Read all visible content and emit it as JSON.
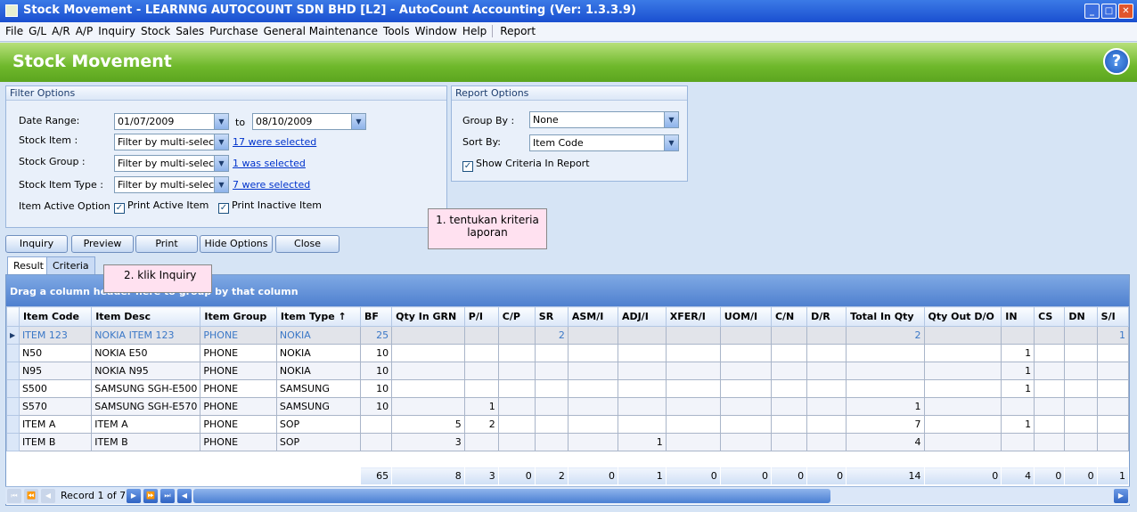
{
  "window": {
    "title": "Stock Movement - LEARNNG AUTOCOUNT SDN BHD [L2] - AutoCount Accounting (Ver: 1.3.3.9)"
  },
  "menu": [
    "File",
    "G/L",
    "A/R",
    "A/P",
    "Inquiry",
    "Stock",
    "Sales",
    "Purchase",
    "General Maintenance",
    "Tools",
    "Window",
    "Help",
    "Report"
  ],
  "banner": {
    "title": "Stock Movement",
    "help": "?"
  },
  "filter": {
    "title": "Filter Options",
    "date_range_label": "Date Range:",
    "date_from": "01/07/2009",
    "to_label": "to",
    "date_to": "08/10/2009",
    "stock_item_label": "Stock Item :",
    "stock_item_value": "Filter by multi-select",
    "stock_item_link": "17 were selected",
    "stock_group_label": "Stock Group :",
    "stock_group_value": "Filter by multi-select",
    "stock_group_link": "1 was selected",
    "stock_type_label": "Stock Item Type :",
    "stock_type_value": "Filter by multi-select",
    "stock_type_link": "7 were selected",
    "active_label": "Item Active Option :",
    "print_active": "Print Active Item",
    "print_inactive": "Print Inactive Item"
  },
  "report": {
    "title": "Report Options",
    "group_label": "Group By :",
    "group_value": "None",
    "sort_label": "Sort By:",
    "sort_value": "Item Code",
    "show_criteria": "Show Criteria In Report"
  },
  "callouts": {
    "one": "1. tentukan kriteria laporan",
    "two": "2. klik Inquiry"
  },
  "buttons": {
    "inquiry": "Inquiry",
    "preview": "Preview",
    "print": "Print",
    "hide": "Hide Options",
    "close": "Close"
  },
  "tabs": {
    "result": "Result",
    "criteria": "Criteria"
  },
  "grid": {
    "drag_hint": "Drag a column header here to group by that column",
    "columns": [
      "Item Code",
      "Item Desc",
      "Item Group",
      "Item Type ↑",
      "BF",
      "Qty In GRN",
      "P/I",
      "C/P",
      "SR",
      "ASM/I",
      "ADJ/I",
      "XFER/I",
      "UOM/I",
      "C/N",
      "D/R",
      "Total In Qty",
      "Qty Out D/O",
      "IN",
      "CS",
      "DN",
      "S/I"
    ],
    "rows": [
      [
        "ITEM 123",
        "NOKIA ITEM 123",
        "PHONE",
        "NOKIA",
        "25",
        "",
        "",
        "",
        "2",
        "",
        "",
        "",
        "",
        "",
        "",
        "2",
        "",
        "",
        "",
        "",
        "1"
      ],
      [
        "N50",
        "NOKIA E50",
        "PHONE",
        "NOKIA",
        "10",
        "",
        "",
        "",
        "",
        "",
        "",
        "",
        "",
        "",
        "",
        "",
        "",
        "1",
        "",
        "",
        ""
      ],
      [
        "N95",
        "NOKIA N95",
        "PHONE",
        "NOKIA",
        "10",
        "",
        "",
        "",
        "",
        "",
        "",
        "",
        "",
        "",
        "",
        "",
        "",
        "1",
        "",
        "",
        ""
      ],
      [
        "S500",
        "SAMSUNG SGH-E500",
        "PHONE",
        "SAMSUNG",
        "10",
        "",
        "",
        "",
        "",
        "",
        "",
        "",
        "",
        "",
        "",
        "",
        "",
        "1",
        "",
        "",
        ""
      ],
      [
        "S570",
        "SAMSUNG SGH-E570",
        "PHONE",
        "SAMSUNG",
        "10",
        "",
        "1",
        "",
        "",
        "",
        "",
        "",
        "",
        "",
        "",
        "1",
        "",
        "",
        "",
        "",
        ""
      ],
      [
        "ITEM A",
        "ITEM A",
        "PHONE",
        "SOP",
        "",
        "5",
        "2",
        "",
        "",
        "",
        "",
        "",
        "",
        "",
        "",
        "7",
        "",
        "1",
        "",
        "",
        ""
      ],
      [
        "ITEM B",
        "ITEM B",
        "PHONE",
        "SOP",
        "",
        "3",
        "",
        "",
        "",
        "",
        "1",
        "",
        "",
        "",
        "",
        "4",
        "",
        "",
        "",
        "",
        ""
      ]
    ],
    "totals": [
      "65",
      "8",
      "3",
      "0",
      "2",
      "0",
      "1",
      "0",
      "0",
      "0",
      "0",
      "14",
      "0",
      "4",
      "0",
      "0",
      "1"
    ]
  },
  "nav": {
    "record": "Record 1 of 7"
  },
  "colors": {
    "banner": "#6eb82b",
    "titlebar": "#1a4fd0",
    "link": "#0033cc"
  }
}
